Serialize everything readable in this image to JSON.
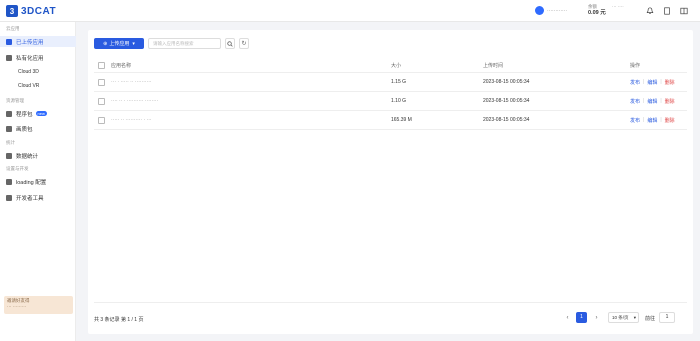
{
  "header": {
    "logo_text": "3DCAT",
    "user_name": "············",
    "balance_label": "余额",
    "balance_value": "0.09 元",
    "plan_label": "··· ····"
  },
  "sidebar": {
    "group1": "云应用",
    "items1": [
      {
        "label": "已上传应用",
        "active": true
      },
      {
        "label": "私有化应用",
        "active": false
      }
    ],
    "sub_items": [
      {
        "label": "Cloud 3D"
      },
      {
        "label": "Cloud VR"
      }
    ],
    "group2": "资源管理",
    "items2": [
      {
        "label": "程序包",
        "badge": "new"
      },
      {
        "label": "画质包"
      }
    ],
    "group3": "统计",
    "items3": [
      {
        "label": "数据统计"
      }
    ],
    "group4": "设置与开发",
    "items4": [
      {
        "label": "loading 配置"
      },
      {
        "label": "开发者工具"
      }
    ],
    "promo_line1": "邀请好友得",
    "promo_line2": "··· ·········"
  },
  "main": {
    "upload_button": "上传应用",
    "search_placeholder": "请输入应用名称搜索",
    "columns": {
      "name": "应用名称",
      "size": "大小",
      "time": "上传时间",
      "actions": "操作"
    },
    "rows": [
      {
        "name": "··· · ·····  ·· ··········",
        "size": "1.15 G",
        "time": "2023-08-15 00:05:34"
      },
      {
        "name": "···· ·· · ··········  ········",
        "size": "1.10 G",
        "time": "2023-08-15 00:05:34"
      },
      {
        "name": "····· ·· ··········  · ···",
        "size": "165.39 M",
        "time": "2023-08-15 00:05:34"
      }
    ],
    "action_labels": {
      "publish": "发布",
      "edit": "编辑",
      "delete": "删除"
    },
    "total_text": "共 3 条记录 第 1 / 1 页",
    "current_page": "1",
    "page_size": "10 条/页",
    "goto_label": "前往",
    "goto_value": "1"
  }
}
